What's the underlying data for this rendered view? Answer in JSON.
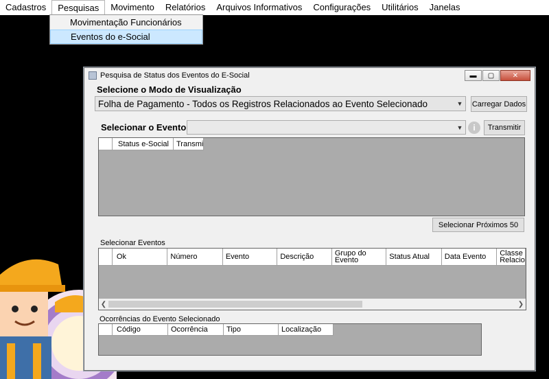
{
  "menubar": {
    "items": [
      "Cadastros",
      "Pesquisas",
      "Movimento",
      "Relatórios",
      "Arquivos Informativos",
      "Configurações",
      "Utilitários",
      "Janelas"
    ],
    "open_menu": "Pesquisas",
    "dropdown": [
      "Movimentação Funcionários",
      "Eventos do e-Social"
    ]
  },
  "window": {
    "title": "Pesquisa de Status dos Eventos do E-Social",
    "mode_label": "Selecione o Modo de Visualização",
    "mode_value": "Folha de Pagamento - Todos os Registros Relacionados ao Evento Selecionado",
    "load_button": "Carregar Dados",
    "event_label": "Selecionar o Evento:",
    "event_value": "",
    "transmit_button": "Transmitir",
    "status_grid": {
      "columns": [
        "Status e-Social",
        "Transmitir"
      ]
    },
    "next_button": "Selecionar Próximos 50",
    "select_events_label": "Selecionar Eventos",
    "events_grid": {
      "columns": [
        "Ok",
        "Número",
        "Evento",
        "Descrição",
        "Grupo do Evento",
        "Status Atual",
        "Data Evento",
        "Classe Relaciona"
      ]
    },
    "occurrences_label": "Ocorrências do Evento Selecionado",
    "occurrences_grid": {
      "columns": [
        "Código",
        "Ocorrência",
        "Tipo",
        "Localização"
      ]
    }
  },
  "colors": {
    "menu_highlight": "#cce8ff",
    "grid_bg": "#ababab",
    "window_bg": "#f0f0f0"
  }
}
